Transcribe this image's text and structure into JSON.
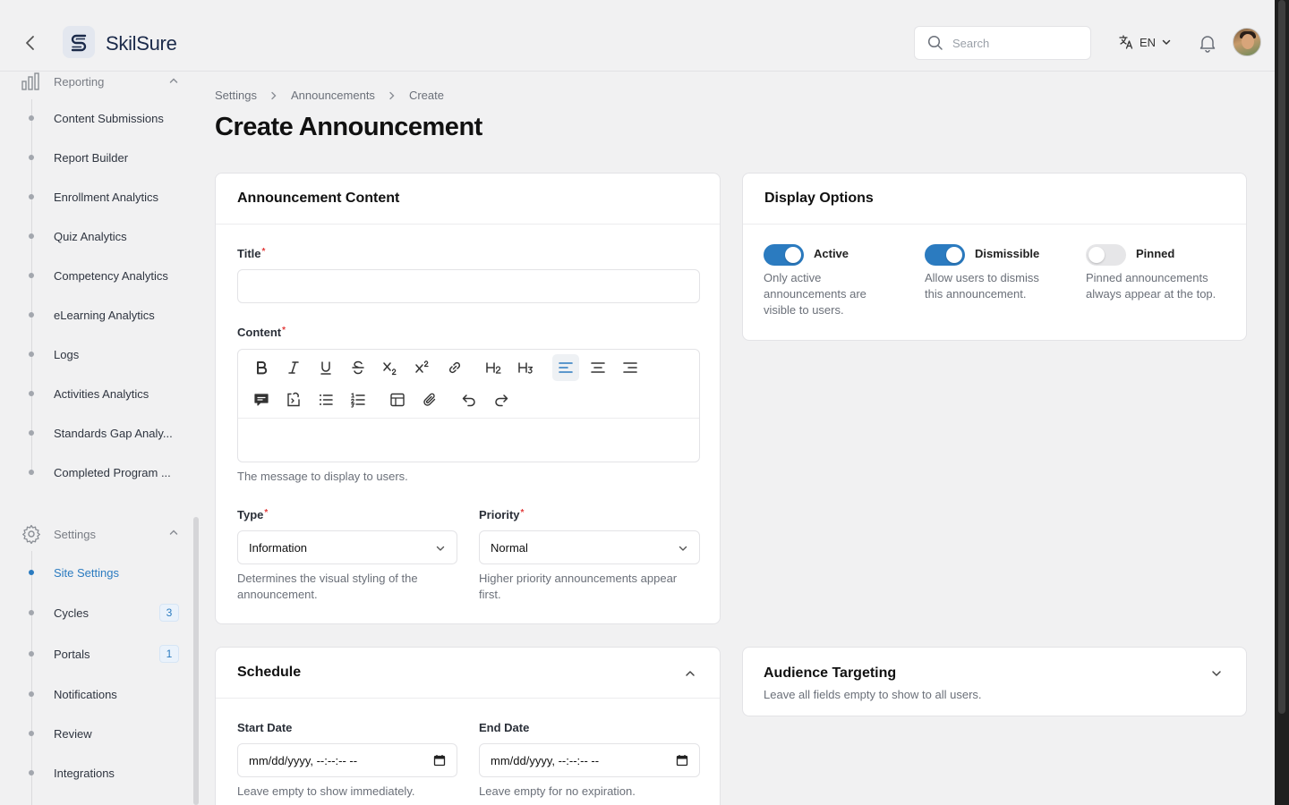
{
  "app": {
    "brand": "SkilSure"
  },
  "header": {
    "search_placeholder": "Search",
    "language": "EN"
  },
  "sidebar": {
    "reporting": {
      "label": "Reporting",
      "items": [
        {
          "label": "Content Submissions"
        },
        {
          "label": "Report Builder"
        },
        {
          "label": "Enrollment Analytics"
        },
        {
          "label": "Quiz Analytics"
        },
        {
          "label": "Competency Analytics"
        },
        {
          "label": "eLearning Analytics"
        },
        {
          "label": "Logs"
        },
        {
          "label": "Activities Analytics"
        },
        {
          "label": "Standards Gap Analy..."
        },
        {
          "label": "Completed Program ..."
        }
      ]
    },
    "settings": {
      "label": "Settings",
      "items": [
        {
          "label": "Site Settings",
          "active": true
        },
        {
          "label": "Cycles",
          "badge": "3"
        },
        {
          "label": "Portals",
          "badge": "1"
        },
        {
          "label": "Notifications"
        },
        {
          "label": "Review"
        },
        {
          "label": "Integrations"
        }
      ]
    }
  },
  "breadcrumb": [
    "Settings",
    "Announcements",
    "Create"
  ],
  "page_title": "Create Announcement",
  "content_card": {
    "title": "Announcement Content",
    "title_label": "Title",
    "title_value": "",
    "content_label": "Content",
    "content_help": "The message to display to users.",
    "type_label": "Type",
    "type_value": "Information",
    "type_help": "Determines the visual styling of the announcement.",
    "priority_label": "Priority",
    "priority_value": "Normal",
    "priority_help": "Higher priority announcements appear first.",
    "required_mark": "*",
    "toolbar": [
      "bold-icon",
      "italic-icon",
      "underline-icon",
      "strikethrough-icon",
      "subscript-icon",
      "superscript-icon",
      "link-icon",
      "heading-2-icon",
      "heading-3-icon",
      "align-left-icon",
      "align-center-icon",
      "align-right-icon",
      "comment-icon",
      "code-block-icon",
      "bullet-list-icon",
      "numbered-list-icon",
      "table-icon",
      "attachment-icon",
      "undo-icon",
      "redo-icon"
    ],
    "toolbar_active": "align-left-icon"
  },
  "display_options": {
    "title": "Display Options",
    "toggles": [
      {
        "label": "Active",
        "on": true,
        "help": "Only active announcements are visible to users."
      },
      {
        "label": "Dismissible",
        "on": true,
        "help": "Allow users to dismiss this announcement."
      },
      {
        "label": "Pinned",
        "on": false,
        "help": "Pinned announcements always appear at the top."
      }
    ]
  },
  "schedule": {
    "title": "Schedule",
    "start_label": "Start Date",
    "start_value": "mm/dd/yyyy, --:--:-- --",
    "start_help": "Leave empty to show immediately.",
    "end_label": "End Date",
    "end_value": "mm/dd/yyyy, --:--:-- --",
    "end_help": "Leave empty for no expiration."
  },
  "audience": {
    "title": "Audience Targeting",
    "subtitle": "Leave all fields empty to show to all users."
  },
  "colors": {
    "accent": "#2b7bc0",
    "required": "#e23b3b",
    "background": "#f1f1f2"
  }
}
